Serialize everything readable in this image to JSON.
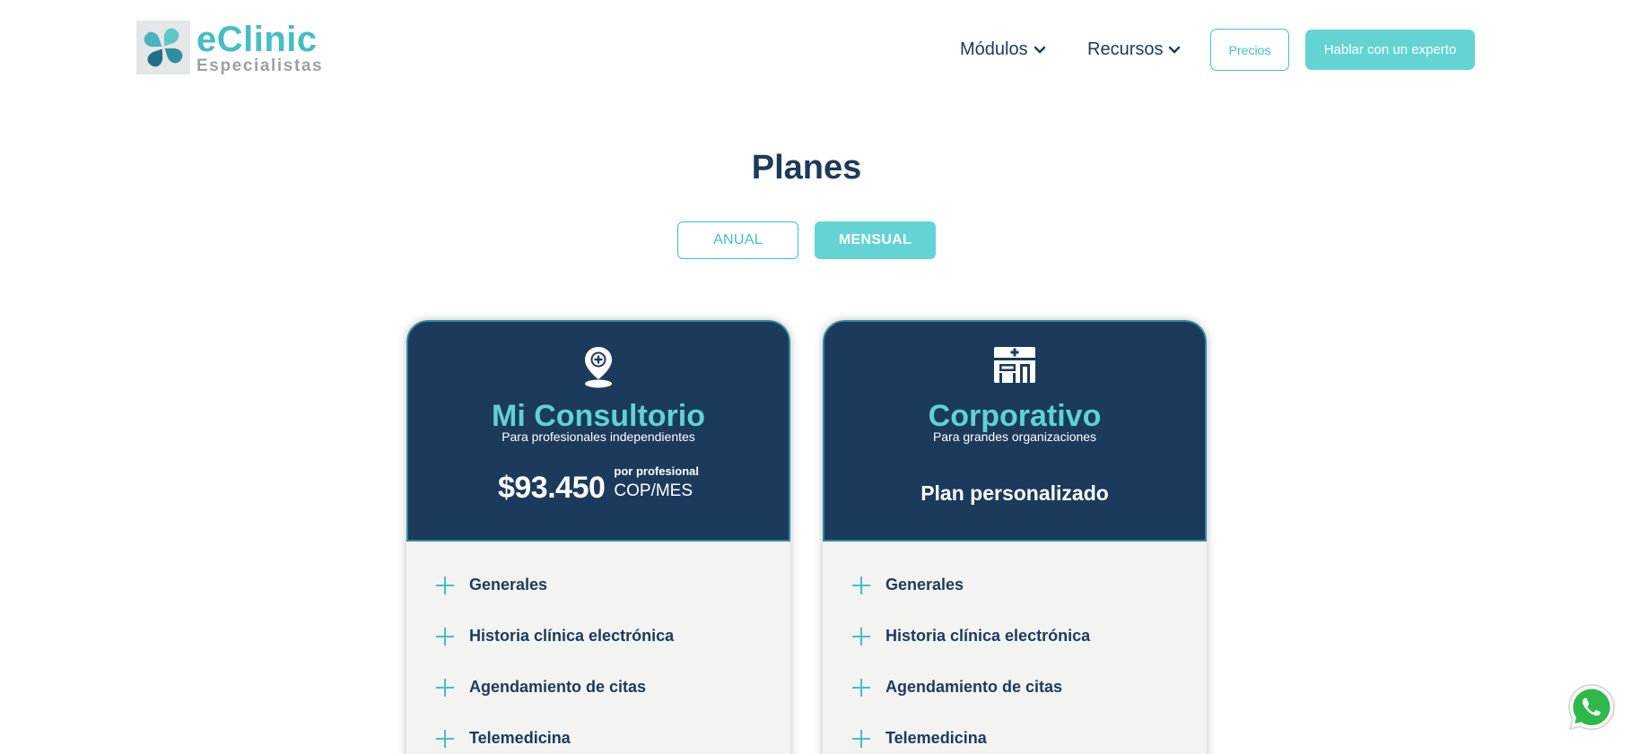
{
  "header": {
    "logo": {
      "title": "eClinic",
      "subtitle": "Especialistas"
    },
    "nav": [
      {
        "label": "Módulos",
        "icon": "chevron-down-icon"
      },
      {
        "label": "Recursos",
        "icon": "chevron-down-icon"
      }
    ],
    "precios_label": "Precios",
    "cta_label": "Hablar con un experto"
  },
  "main": {
    "title": "Planes",
    "billing_toggle": {
      "anual": "ANUAL",
      "mensual": "MENSUAL",
      "selected": "MENSUAL"
    },
    "plans": [
      {
        "icon": "location-pin-plus-icon",
        "name": "Mi Consultorio",
        "description": "Para profesionales independientes",
        "price": "$93.450",
        "price_unit_top": "por profesional",
        "price_unit_bottom": "COP/MES",
        "features": [
          "Generales",
          "Historia clínica electrónica",
          "Agendamiento de citas",
          "Telemedicina"
        ]
      },
      {
        "icon": "hospital-building-icon",
        "name": "Corporativo",
        "description": "Para grandes organizaciones",
        "price_text": "Plan personalizado",
        "features": [
          "Generales",
          "Historia clínica electrónica",
          "Agendamiento de citas",
          "Telemedicina"
        ]
      }
    ]
  },
  "floating": {
    "icon": "whatsapp-icon"
  },
  "colors": {
    "accent": "#45bec4",
    "accent_fill": "#64d3d3",
    "navy": "#1c3a5c",
    "card_body": "#f3f3f1",
    "whatsapp_green": "#2fb94a"
  }
}
